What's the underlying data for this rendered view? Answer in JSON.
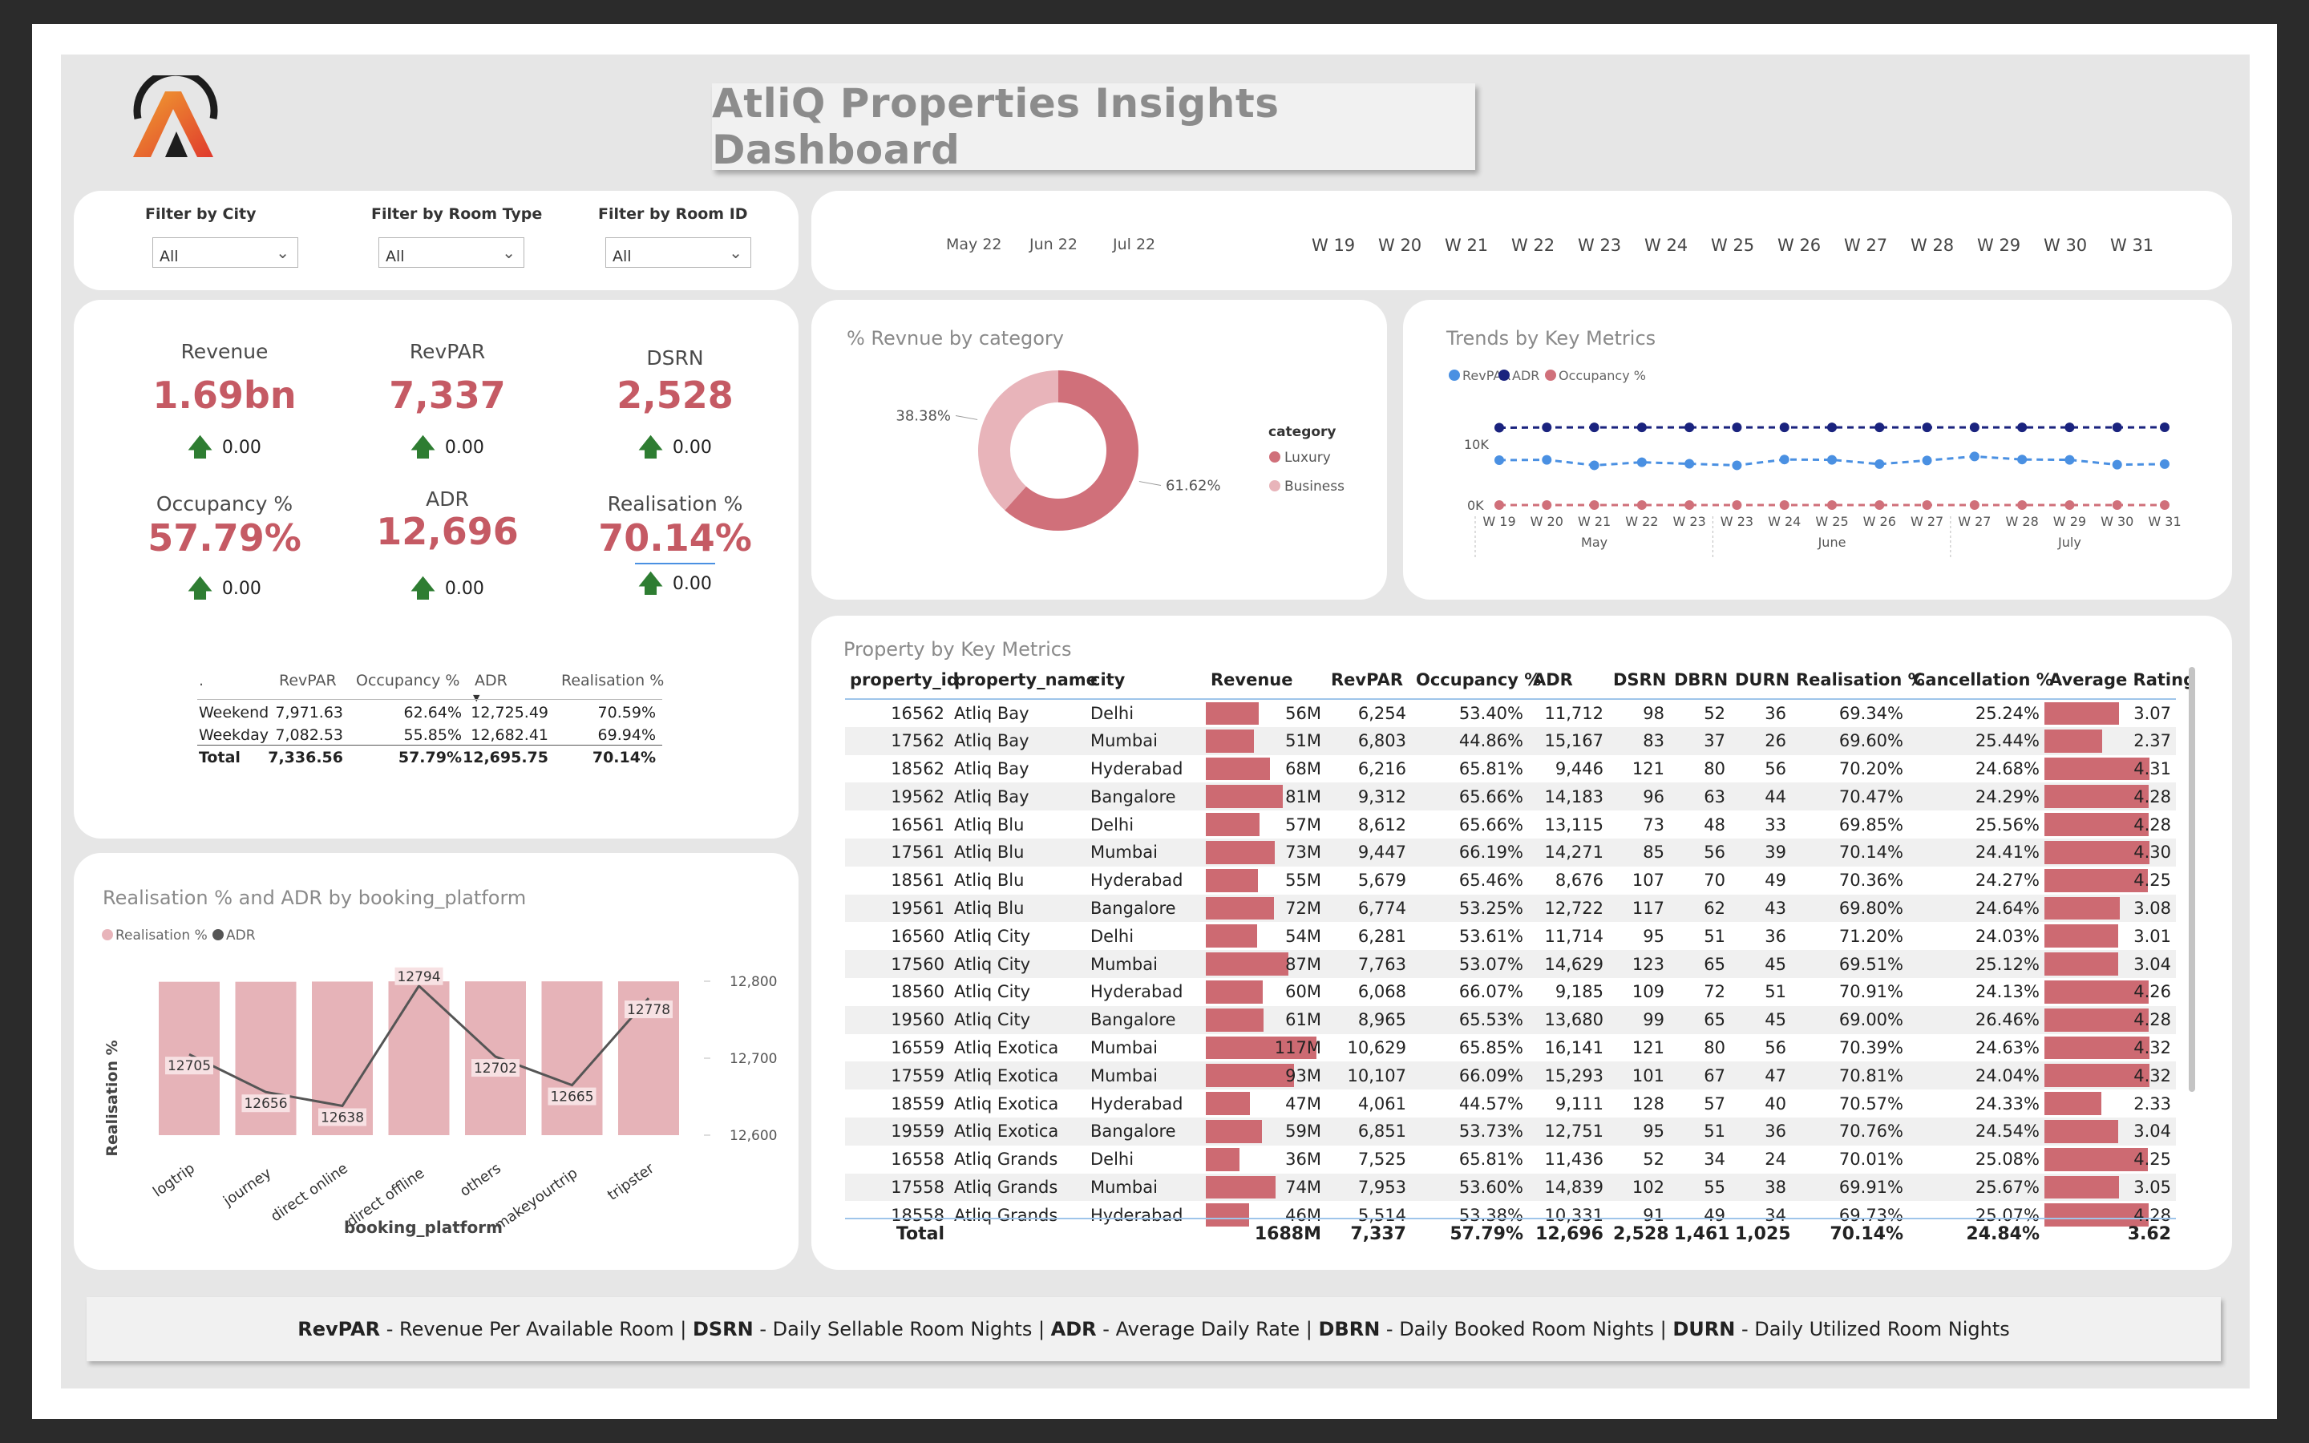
{
  "dashboard": {
    "title": "AtliQ Properties Insights Dashboard",
    "logo_mark": "AtliQ logo"
  },
  "filters": [
    {
      "label": "Filter by City",
      "value": "All"
    },
    {
      "label": "Filter by Room Type",
      "value": "All"
    },
    {
      "label": "Filter by Room ID",
      "value": "All"
    }
  ],
  "date_slicer": {
    "months": [
      "May 22",
      "Jun 22",
      "Jul 22"
    ],
    "weeks": [
      "W 19",
      "W 20",
      "W 21",
      "W 22",
      "W 23",
      "W 24",
      "W 25",
      "W 26",
      "W 27",
      "W 28",
      "W 29",
      "W 30",
      "W 31"
    ]
  },
  "kpis": [
    {
      "label": "Revenue",
      "value": "1.69bn",
      "delta": "0.00"
    },
    {
      "label": "RevPAR",
      "value": "7,337",
      "delta": "0.00"
    },
    {
      "label": "DSRN",
      "value": "2,528",
      "delta": "0.00"
    },
    {
      "label": "Occupancy %",
      "value": "57.79%",
      "delta": "0.00"
    },
    {
      "label": "ADR",
      "value": "12,696",
      "delta": "0.00"
    },
    {
      "label": "Realisation %",
      "value": "70.14%",
      "delta": "0.00"
    }
  ],
  "weekday_table": {
    "headers": [
      ".",
      "RevPAR",
      "Occupancy %",
      "ADR",
      "Realisation %"
    ],
    "rows": [
      [
        "Weekend",
        "7,971.63",
        "62.64%",
        "12,725.49",
        "70.59%"
      ],
      [
        "Weekday",
        "7,082.53",
        "55.85%",
        "12,682.41",
        "69.94%"
      ],
      [
        "Total",
        "7,336.56",
        "57.79%",
        "12,695.75",
        "70.14%"
      ]
    ]
  },
  "colors": {
    "accent": "#c55a64",
    "bar": "#cd6a72",
    "luxury": "#d0707a",
    "business": "#e8b4ba",
    "revpar": "#4a90e2",
    "adr": "#1a237e",
    "occupancy": "#d0707a",
    "up_arrow": "#2e7d32"
  },
  "charts": {
    "donut_title": "% Revnue by category",
    "donut_legend_title": "category",
    "trends_title": "Trends by Key Metrics",
    "combo_title": "Realisation % and ADR by booking_platform"
  },
  "chart_data": [
    {
      "type": "pie",
      "title": "% Revnue by category",
      "categories": [
        "Luxury",
        "Business"
      ],
      "values": [
        61.62,
        38.38
      ],
      "labels": [
        "61.62%",
        "38.38%"
      ],
      "legend_title": "category",
      "legend": "right"
    },
    {
      "type": "line",
      "title": "Trends by Key Metrics",
      "x": [
        "W 19",
        "W 20",
        "W 21",
        "W 22",
        "W 23",
        "W 23",
        "W 24",
        "W 25",
        "W 26",
        "W 27",
        "W 27",
        "W 28",
        "W 29",
        "W 30",
        "W 31"
      ],
      "x_groups": [
        {
          "label": "May",
          "from": 0,
          "to": 4
        },
        {
          "label": "June",
          "from": 5,
          "to": 9
        },
        {
          "label": "July",
          "from": 10,
          "to": 14
        }
      ],
      "y_ticks": [
        "0K",
        "10K"
      ],
      "ylim": [
        0,
        16000
      ],
      "series": [
        {
          "name": "RevPAR",
          "values": [
            7350,
            7400,
            6500,
            7000,
            6750,
            6500,
            7450,
            7400,
            6700,
            7300,
            7950,
            7450,
            7400,
            6600,
            6700
          ]
        },
        {
          "name": "ADR",
          "values": [
            12650,
            12700,
            12700,
            12700,
            12700,
            12700,
            12700,
            12700,
            12700,
            12700,
            12700,
            12700,
            12700,
            12700,
            12720
          ]
        },
        {
          "name": "Occupancy %",
          "values": [
            58,
            58,
            52,
            56,
            54,
            52,
            59,
            58,
            53,
            58,
            63,
            59,
            59,
            52,
            53
          ]
        }
      ],
      "legend": "top-left"
    },
    {
      "type": "bar",
      "title": "Realisation % and ADR by booking_platform",
      "xlabel": "booking_platform",
      "ylabel": "Realisation %",
      "categories": [
        "logtrip",
        "journey",
        "direct online",
        "direct offline",
        "others",
        "makeyourtrip",
        "tripster"
      ],
      "series": [
        {
          "name": "Realisation %",
          "values": [
            70.0,
            70.0,
            70.1,
            70.2,
            70.2,
            70.2,
            70.2
          ]
        },
        {
          "name": "ADR",
          "values": [
            12705,
            12656,
            12638,
            12794,
            12702,
            12665,
            12778
          ]
        }
      ],
      "data_labels": [
        "12705",
        "12656",
        "12638",
        "12794",
        "12702",
        "12665",
        "12778"
      ],
      "secondary_y_ticks": [
        "12,800",
        "12,700",
        "12,600"
      ],
      "secondary_ylim": [
        12600,
        12800
      ],
      "legend": "top-left"
    }
  ],
  "property_table": {
    "title": "Property by Key Metrics",
    "headers": [
      "property_id",
      "property_name",
      "city",
      "Revenue",
      "RevPAR",
      "Occupancy %",
      "ADR",
      "DSRN",
      "DBRN",
      "DURN",
      "Realisation %",
      "Cancellation %",
      "Average Rating"
    ],
    "revenue_max": 117,
    "rating_max": 5,
    "rows": [
      [
        "16562",
        "Atliq Bay",
        "Delhi",
        "56M",
        "6,254",
        "53.40%",
        "11,712",
        "98",
        "52",
        "36",
        "69.34%",
        "25.24%",
        "3.07"
      ],
      [
        "17562",
        "Atliq Bay",
        "Mumbai",
        "51M",
        "6,803",
        "44.86%",
        "15,167",
        "83",
        "37",
        "26",
        "69.60%",
        "25.44%",
        "2.37"
      ],
      [
        "18562",
        "Atliq Bay",
        "Hyderabad",
        "68M",
        "6,216",
        "65.81%",
        "9,446",
        "121",
        "80",
        "56",
        "70.20%",
        "24.68%",
        "4.31"
      ],
      [
        "19562",
        "Atliq Bay",
        "Bangalore",
        "81M",
        "9,312",
        "65.66%",
        "14,183",
        "96",
        "63",
        "44",
        "70.47%",
        "24.29%",
        "4.28"
      ],
      [
        "16561",
        "Atliq Blu",
        "Delhi",
        "57M",
        "8,612",
        "65.66%",
        "13,115",
        "73",
        "48",
        "33",
        "69.85%",
        "25.56%",
        "4.28"
      ],
      [
        "17561",
        "Atliq Blu",
        "Mumbai",
        "73M",
        "9,447",
        "66.19%",
        "14,271",
        "85",
        "56",
        "39",
        "70.14%",
        "24.41%",
        "4.30"
      ],
      [
        "18561",
        "Atliq Blu",
        "Hyderabad",
        "55M",
        "5,679",
        "65.46%",
        "8,676",
        "107",
        "70",
        "49",
        "70.36%",
        "24.27%",
        "4.25"
      ],
      [
        "19561",
        "Atliq Blu",
        "Bangalore",
        "72M",
        "6,774",
        "53.25%",
        "12,722",
        "117",
        "62",
        "43",
        "69.80%",
        "24.64%",
        "3.08"
      ],
      [
        "16560",
        "Atliq City",
        "Delhi",
        "54M",
        "6,281",
        "53.61%",
        "11,714",
        "95",
        "51",
        "36",
        "71.20%",
        "24.03%",
        "3.01"
      ],
      [
        "17560",
        "Atliq City",
        "Mumbai",
        "87M",
        "7,763",
        "53.07%",
        "14,629",
        "123",
        "65",
        "45",
        "69.51%",
        "25.12%",
        "3.04"
      ],
      [
        "18560",
        "Atliq City",
        "Hyderabad",
        "60M",
        "6,068",
        "66.07%",
        "9,185",
        "109",
        "72",
        "51",
        "70.91%",
        "24.13%",
        "4.26"
      ],
      [
        "19560",
        "Atliq City",
        "Bangalore",
        "61M",
        "8,965",
        "65.53%",
        "13,680",
        "99",
        "65",
        "45",
        "69.00%",
        "26.46%",
        "4.28"
      ],
      [
        "16559",
        "Atliq Exotica",
        "Mumbai",
        "117M",
        "10,629",
        "65.85%",
        "16,141",
        "121",
        "80",
        "56",
        "70.39%",
        "24.63%",
        "4.32"
      ],
      [
        "17559",
        "Atliq Exotica",
        "Mumbai",
        "93M",
        "10,107",
        "66.09%",
        "15,293",
        "101",
        "67",
        "47",
        "70.81%",
        "24.04%",
        "4.32"
      ],
      [
        "18559",
        "Atliq Exotica",
        "Hyderabad",
        "47M",
        "4,061",
        "44.57%",
        "9,111",
        "128",
        "57",
        "40",
        "70.57%",
        "24.33%",
        "2.33"
      ],
      [
        "19559",
        "Atliq Exotica",
        "Bangalore",
        "59M",
        "6,851",
        "53.73%",
        "12,751",
        "95",
        "51",
        "36",
        "70.76%",
        "24.54%",
        "3.04"
      ],
      [
        "16558",
        "Atliq Grands",
        "Delhi",
        "36M",
        "7,525",
        "65.81%",
        "11,436",
        "52",
        "34",
        "24",
        "70.01%",
        "25.08%",
        "4.25"
      ],
      [
        "17558",
        "Atliq Grands",
        "Mumbai",
        "74M",
        "7,953",
        "53.60%",
        "14,839",
        "102",
        "55",
        "38",
        "69.91%",
        "25.67%",
        "3.05"
      ],
      [
        "18558",
        "Atliq Grands",
        "Hyderabad",
        "46M",
        "5,514",
        "53.38%",
        "10,331",
        "91",
        "49",
        "34",
        "69.73%",
        "25.07%",
        "4.28"
      ]
    ],
    "totals": [
      "Total",
      "",
      "",
      "1688M",
      "7,337",
      "57.79%",
      "12,696",
      "2,528",
      "1,461",
      "1,025",
      "70.14%",
      "24.84%",
      "3.62"
    ]
  },
  "footer": [
    {
      "abbr": "RevPAR",
      "text": " - Revenue Per Available Room | "
    },
    {
      "abbr": "DSRN",
      "text": " - Daily Sellable Room Nights | "
    },
    {
      "abbr": "ADR",
      "text": " - Average Daily Rate | "
    },
    {
      "abbr": "DBRN",
      "text": " - Daily Booked Room Nights | "
    },
    {
      "abbr": "DURN",
      "text": " - Daily Utilized Room Nights"
    }
  ]
}
